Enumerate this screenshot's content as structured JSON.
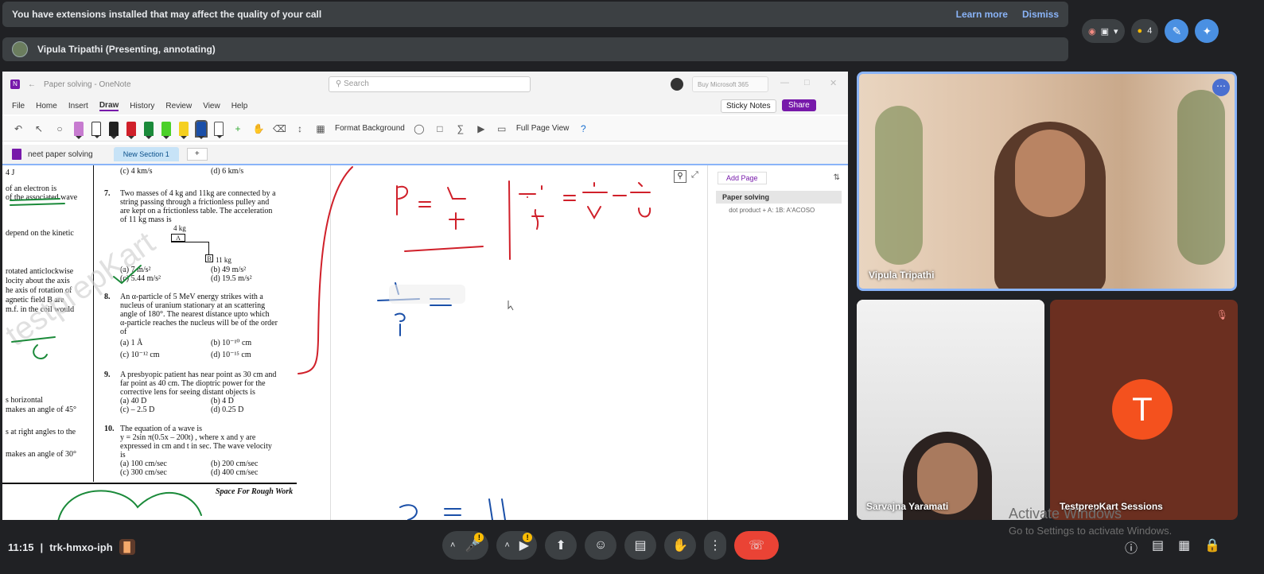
{
  "banner": {
    "message": "You have extensions installed that may affect the quality of your call",
    "learn_more": "Learn more",
    "dismiss": "Dismiss"
  },
  "presenter": {
    "label": "Vipula Tripathi (Presenting, annotating)"
  },
  "top_right": {
    "people_count": "4"
  },
  "onenote": {
    "title": "Paper solving - OneNote",
    "search_placeholder": "Search",
    "buy_ms": "Buy Microsoft 365",
    "menu": [
      "File",
      "Home",
      "Insert",
      "Draw",
      "History",
      "Review",
      "View",
      "Help"
    ],
    "sticky_notes": "Sticky Notes",
    "share": "Share",
    "format_background": "Format Background",
    "full_page_view": "Full Page View",
    "notebook": "neet paper solving",
    "section": "New Section 1",
    "add_page": "Add Page",
    "page_title": "Paper solving",
    "page_sub": "\u0002 dot product + A: 1B: A'ACOSO",
    "paper": {
      "q6_opts": [
        "(c)  4 km/s",
        "(d)  6 km/s"
      ],
      "q7": [
        "Two masses of 4 kg and 11kg are connected by a",
        "string passing through a frictionless pulley and",
        "are kept on a frictionless table. The acceleration",
        "of 11 kg mass is"
      ],
      "q7_opts": [
        "(a)  7 m/s²",
        "(b)  49 m/s²",
        "(c)  5.44 m/s²",
        "(d)  19.5 m/s²"
      ],
      "q7_fig": [
        "4 kg",
        "A",
        "B",
        "11 kg"
      ],
      "q8": [
        "An α-particle of 5 MeV energy strikes with a",
        "nucleus of uranium stationary at an scattering",
        "angle of 180°. The nearest distance upto which",
        "α-particle reaches the nucleus will be of the order",
        "of"
      ],
      "q8_opts": [
        "(a)  1 Å",
        "(b)  10⁻¹⁰ cm",
        "(c)  10⁻¹² cm",
        "(d)  10⁻¹⁵ cm"
      ],
      "q9": [
        "A presbyopic patient has near point as 30 cm and",
        "far point as 40 cm. The dioptric power for the",
        "corrective lens for seeing distant objects is"
      ],
      "q9_opts": [
        "(a)  40 D",
        "(b)  4 D",
        "(c)  – 2.5 D",
        "(d)  0.25 D"
      ],
      "q10": [
        "The    equation    of    a    wave    is",
        "y = 2sin π(0.5x – 200t) ,  where  x  and  y  are",
        "expressed in cm and t in sec. The wave velocity",
        "is"
      ],
      "q10_opts": [
        "(a)  100 cm/sec",
        "(b)  200 cm/sec",
        "(c)  300 cm/sec",
        "(d)  400 cm/sec"
      ],
      "nums": [
        "7.",
        "8.",
        "9.",
        "10."
      ],
      "left_frag": [
        "4 J",
        "of an electron is",
        "of the associated wave",
        "depend on the kinetic",
        "rotated anticlockwise",
        "locity about the axis",
        "he axis of rotation of",
        "agnetic field B are",
        "m.f. in the coil would",
        "s horizontal",
        "makes an angle of 45°",
        "s at right angles to the",
        "makes an angle of 30°"
      ],
      "rough": "Space For Rough Work",
      "watermark": "testprepKart"
    }
  },
  "tiles": [
    {
      "name": "Vipula Tripathi"
    },
    {
      "name": "Sarvajna Yaramati"
    },
    {
      "name": "TestprepKart Sessions",
      "initial": "T"
    }
  ],
  "windows": {
    "line1": "Activate Windows",
    "line2": "Go to Settings to activate Windows."
  },
  "meeting": {
    "time": "11:15",
    "separator": "|",
    "code": "trk-hmxo-iph"
  },
  "colors": {
    "accent": "#8ab4f8",
    "end": "#ea4335",
    "ink_red": "#d0202a",
    "ink_blue": "#1a4fa8",
    "onenote": "#7719aa"
  }
}
